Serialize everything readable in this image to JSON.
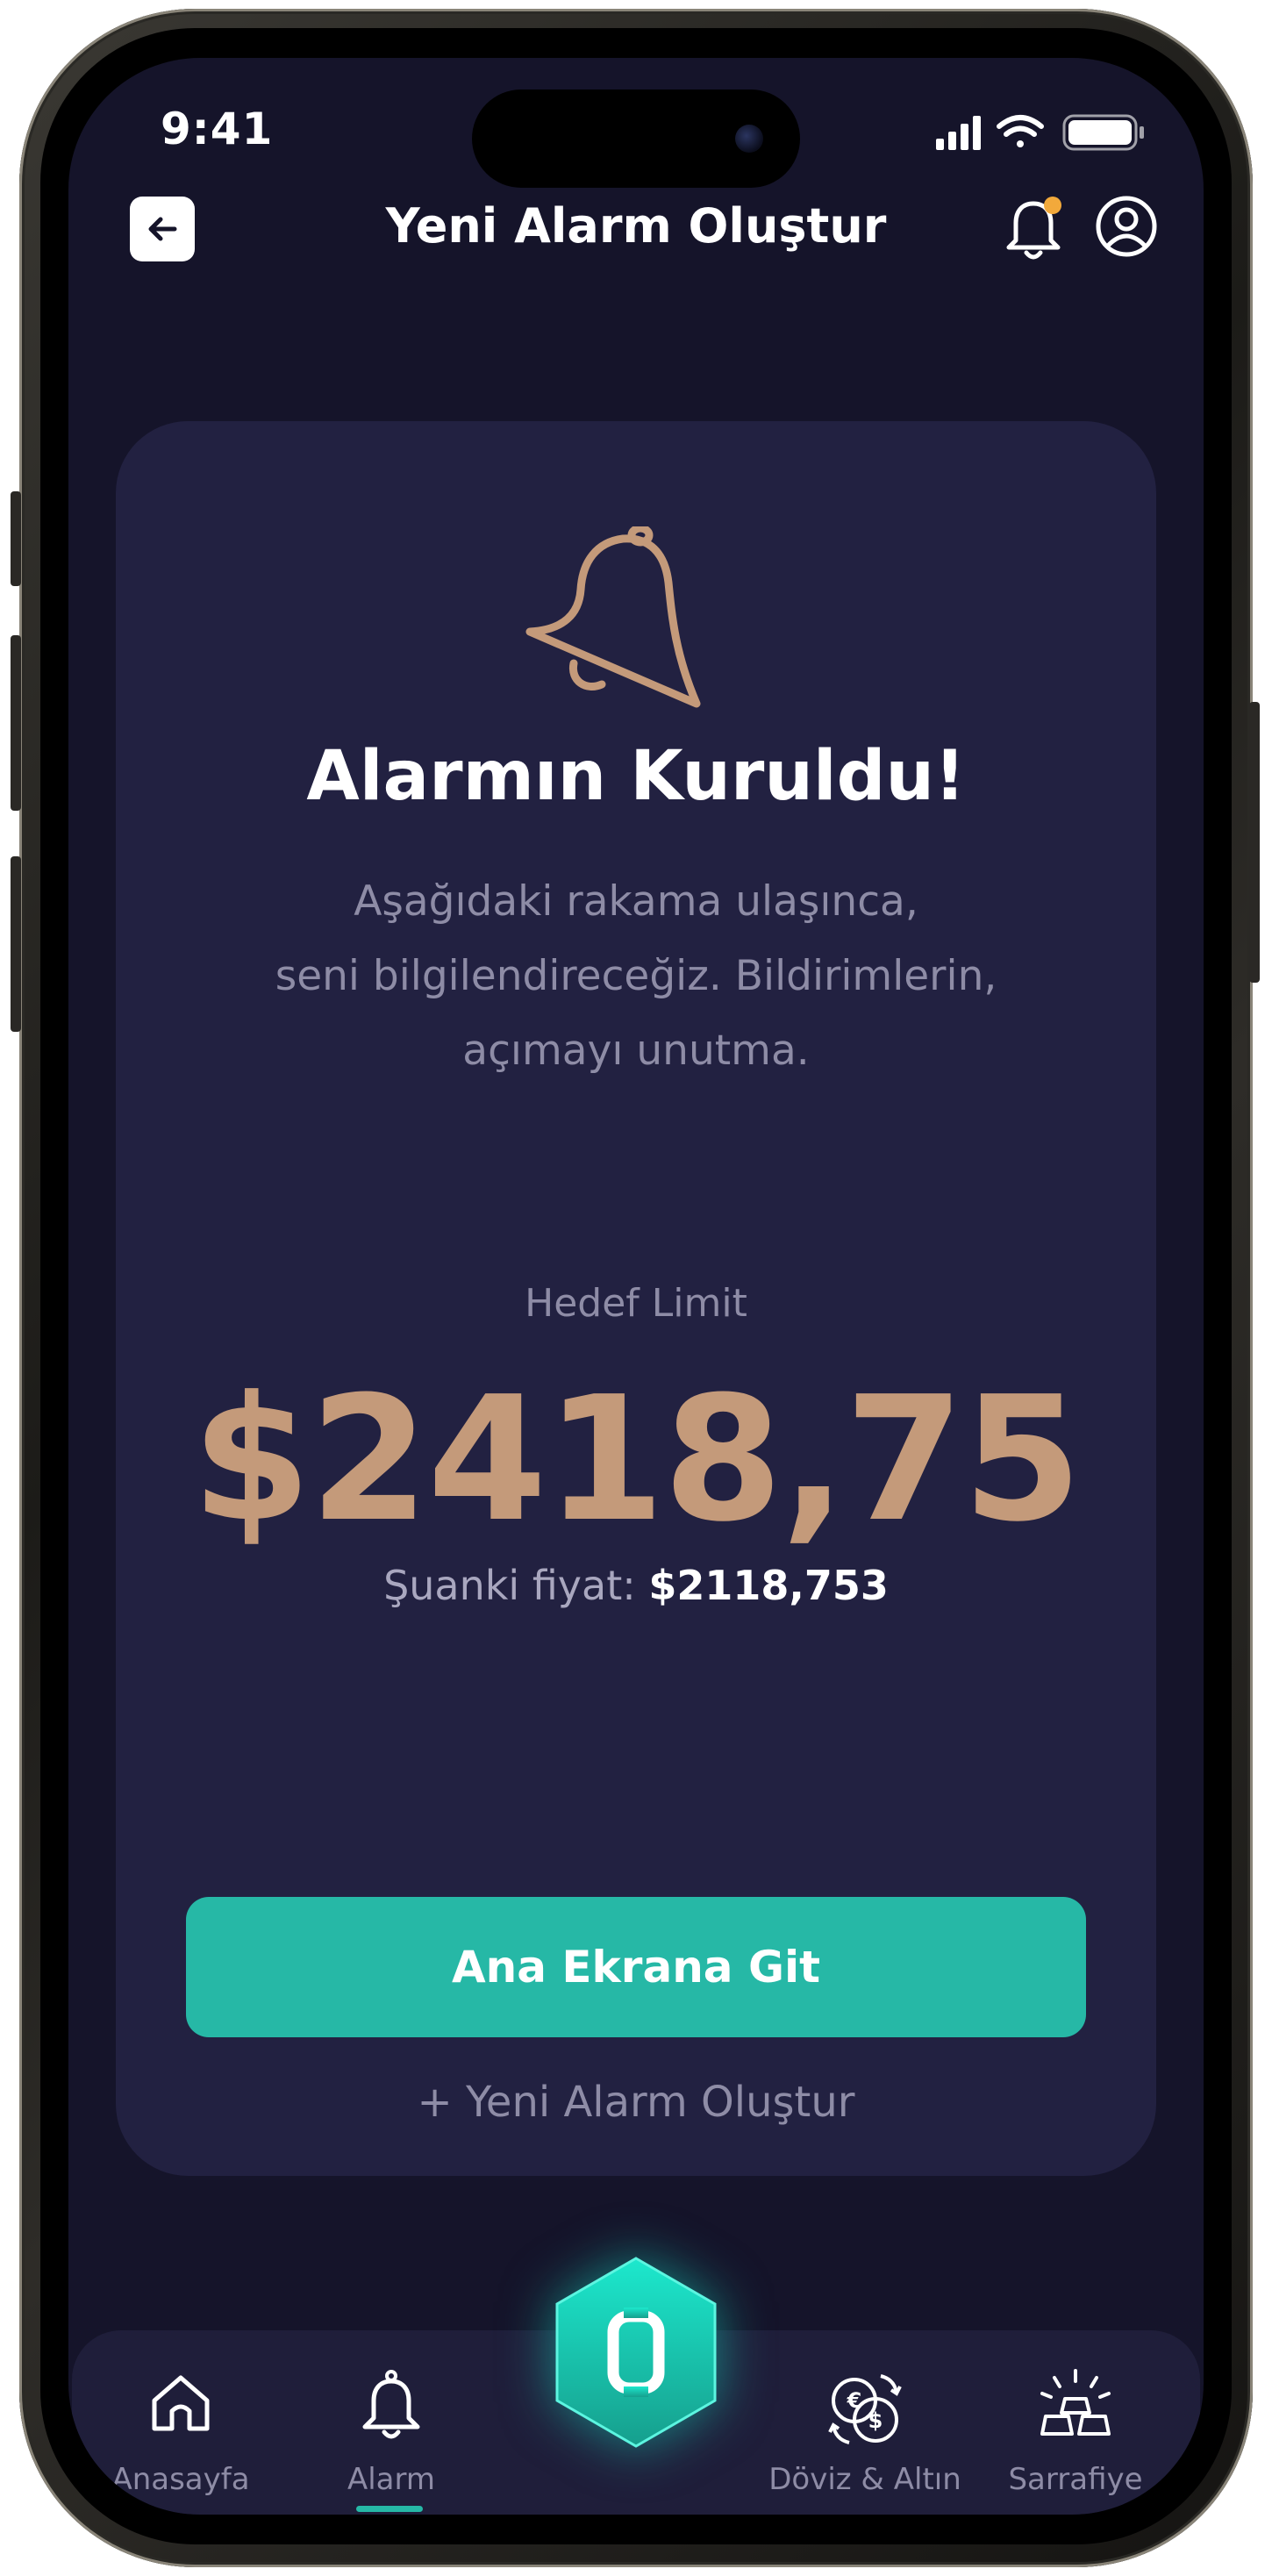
{
  "status_bar": {
    "time": "9:41"
  },
  "header": {
    "title": "Yeni Alarm Oluştur",
    "back_icon": "arrow-left-icon",
    "notification_icon": "bell-icon",
    "notification_dot_color": "#f2a93b",
    "profile_icon": "user-circle-icon"
  },
  "card": {
    "icon": "bell-icon",
    "title": "Alarmın Kuruldu!",
    "description_lines": [
      "Aşağıdaki rakama ulaşınca,",
      "seni bilgilendireceğiz. Bildirimlerin,",
      "açımayı unutma."
    ],
    "target_label": "Hedef Limit",
    "target_value": "$2418,75",
    "current_label": "Şuanki fiyat:",
    "current_value": "$2118,753",
    "primary_button": "Ana Ekrana Git",
    "secondary_link": "+ Yeni Alarm Oluştur"
  },
  "bottom_nav": {
    "items": [
      {
        "label": "Anasayfa",
        "icon": "home-icon"
      },
      {
        "label": "Alarm",
        "icon": "bell-icon",
        "active": true
      },
      {
        "label": "",
        "icon": "hexagon-logo-icon"
      },
      {
        "label": "Döviz & Altın",
        "icon": "currency-exchange-icon"
      },
      {
        "label": "Sarrafiye",
        "icon": "gold-bars-icon"
      }
    ]
  },
  "colors": {
    "background": "#15142a",
    "card": "#222141",
    "accent": "#26b8a6",
    "target_value": "#c49a7a",
    "muted_text": "#8e8ca6"
  }
}
